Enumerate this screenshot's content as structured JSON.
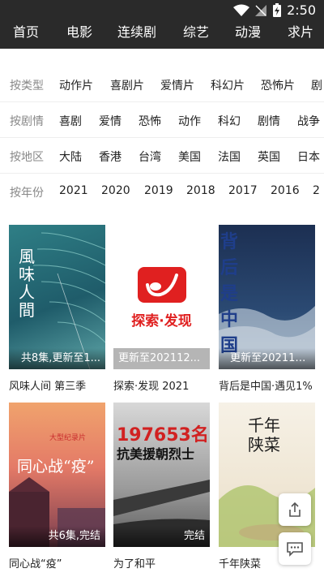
{
  "status_bar": {
    "time": "2:50"
  },
  "nav": {
    "items": [
      "首页",
      "电影",
      "连续剧",
      "综艺",
      "动漫",
      "求片"
    ]
  },
  "filters": [
    {
      "label": "按类型",
      "options": [
        "动作片",
        "喜剧片",
        "爱情片",
        "科幻片",
        "恐怖片",
        "剧"
      ]
    },
    {
      "label": "按剧情",
      "options": [
        "喜剧",
        "爱情",
        "恐怖",
        "动作",
        "科幻",
        "剧情",
        "战争"
      ]
    },
    {
      "label": "按地区",
      "options": [
        "大陆",
        "香港",
        "台湾",
        "美国",
        "法国",
        "英国",
        "日本"
      ]
    },
    {
      "label": "按年份",
      "options": [
        "2021",
        "2020",
        "2019",
        "2018",
        "2017",
        "2016",
        "2"
      ]
    }
  ],
  "cards": [
    {
      "title": "风味人间 第三季",
      "badge": "共8集,更新至1...",
      "poster_text": "風味人間"
    },
    {
      "title": "探索·发现 2021",
      "badge": "更新至202112...",
      "poster_text": "探索·发现"
    },
    {
      "title": "背后是中国·遇见1%",
      "badge": "更新至202112...",
      "poster_text": "背后是中国"
    },
    {
      "title": "同心战“疫”",
      "badge": "共6集,完结",
      "poster_text": "同心战“疫”",
      "poster_sub": "大型纪录片"
    },
    {
      "title": "为了和平",
      "badge": "完结",
      "poster_text": "197653名",
      "poster_sub": "抗美援朝烈士"
    },
    {
      "title": "千年陕菜",
      "badge": "",
      "poster_text": "千年陕菜"
    }
  ],
  "colors": {
    "header": "#2a2a2a",
    "accent": "#e02020"
  }
}
